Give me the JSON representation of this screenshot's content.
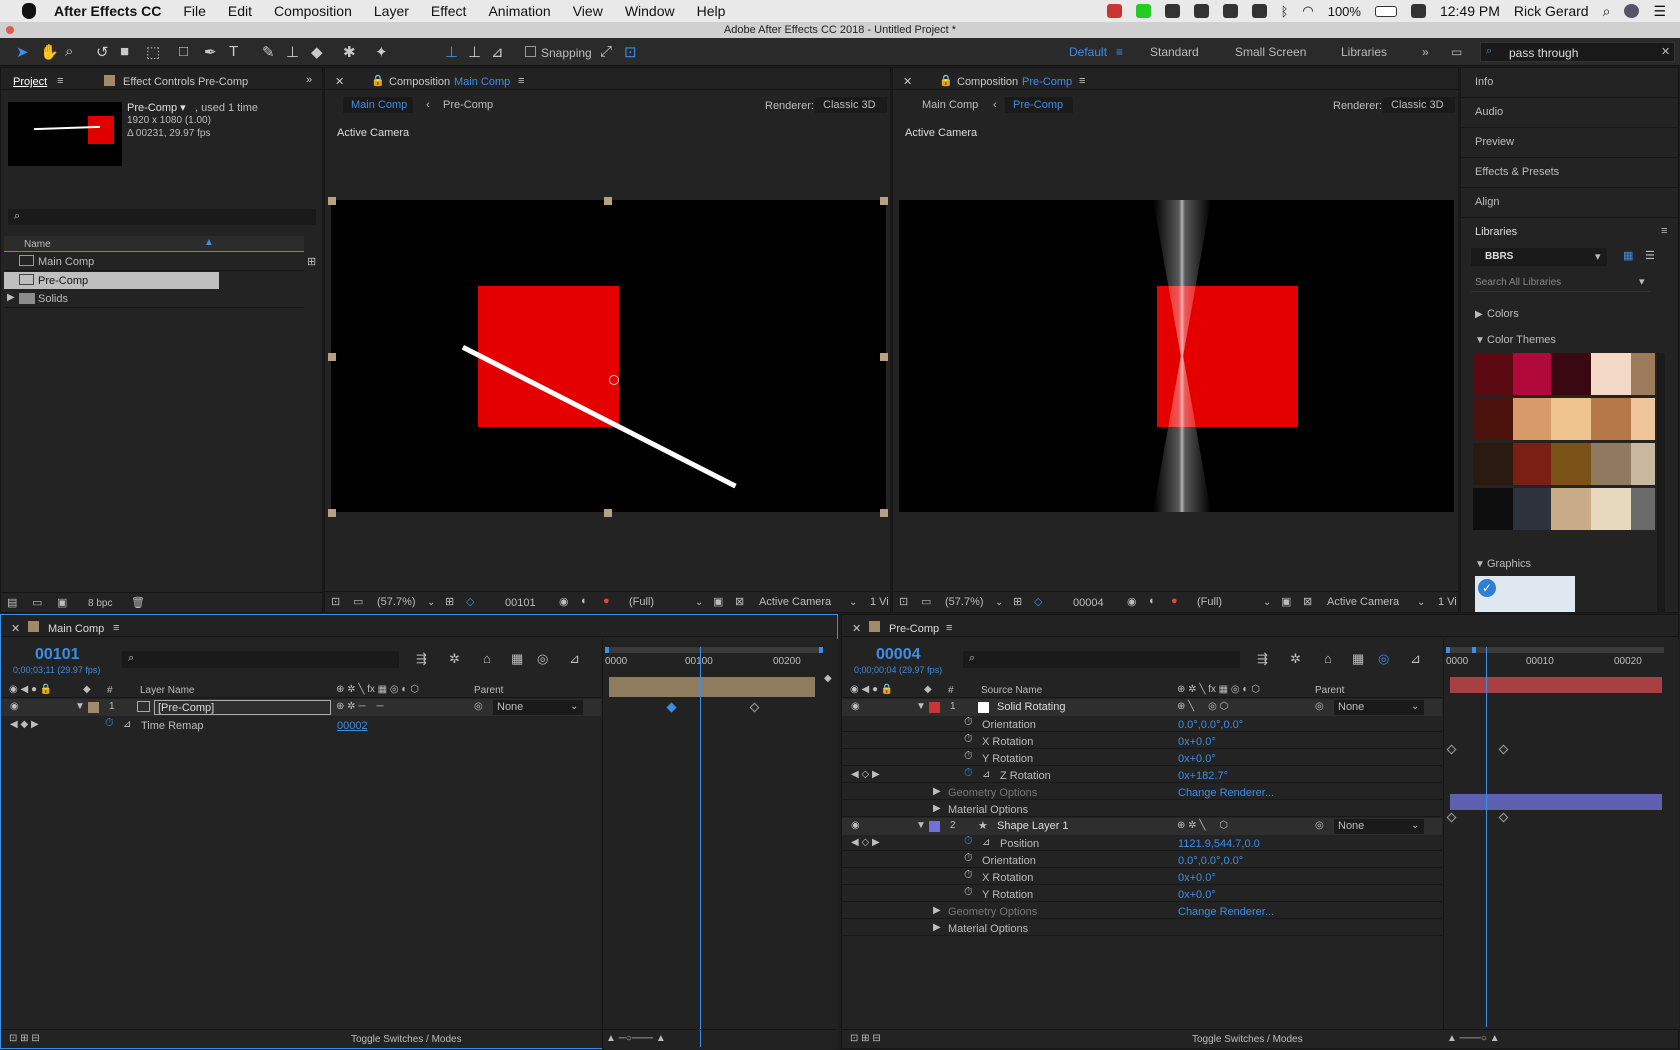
{
  "menubar": {
    "app": "After Effects CC",
    "items": [
      "File",
      "Edit",
      "Composition",
      "Layer",
      "Effect",
      "Animation",
      "View",
      "Window",
      "Help"
    ],
    "battery": "100%",
    "time": "12:49 PM",
    "user": "Rick Gerard"
  },
  "window": {
    "title": "Adobe After Effects CC 2018 - Untitled Project *"
  },
  "toolbar": {
    "snapping": "Snapping",
    "workspaces": [
      "Default",
      "Standard",
      "Small Screen",
      "Libraries"
    ],
    "search_value": "pass through"
  },
  "project": {
    "tab_project": "Project",
    "tab_effects": "Effect Controls Pre-Comp",
    "item_name": "Pre-Comp ▾",
    "item_used": ", used 1 time",
    "item_size": "1920 x 1080 (1.00)",
    "item_duration": "Δ 00231, 29.97 fps",
    "col_name": "Name",
    "items": [
      "Main Comp",
      "Pre-Comp",
      "Solids"
    ],
    "bpc": "8 bpc"
  },
  "viewer1": {
    "tab_prefix": "Composition",
    "tab_name": "Main Comp",
    "crumb_main": "Main Comp",
    "crumb_pre": "Pre-Comp",
    "renderer_label": "Renderer:",
    "renderer": "Classic 3D",
    "camera": "Active Camera",
    "zoom": "(57.7%)",
    "frame": "00101",
    "res": "(Full)",
    "view": "Active Camera",
    "views": "1 Vi"
  },
  "viewer2": {
    "tab_prefix": "Composition",
    "tab_name": "Pre-Comp",
    "crumb_main": "Main Comp",
    "crumb_pre": "Pre-Comp",
    "renderer_label": "Renderer:",
    "renderer": "Classic 3D",
    "camera": "Active Camera",
    "zoom": "(57.7%)",
    "frame": "00004",
    "res": "(Full)",
    "view": "Active Camera",
    "views": "1 Vi"
  },
  "right": {
    "items": [
      "Info",
      "Audio",
      "Preview",
      "Effects & Presets",
      "Align"
    ],
    "libraries": "Libraries",
    "library_name": "BBRS",
    "search": "Search All Libraries",
    "colors": "Colors",
    "color_themes": "Color Themes",
    "graphics": "Graphics",
    "theme_colors": [
      [
        "#5a0a10",
        "#b0093a",
        "#3a0810",
        "#f3d9c6",
        "#9e7a5c"
      ],
      [
        "#4b130c",
        "#d99a6a",
        "#f0c48e",
        "#b57648",
        "#f0c59c"
      ],
      [
        "#2a1a10",
        "#7a1f14",
        "#7a5218",
        "#8f7a5f",
        "#c8b8a0"
      ],
      [
        "#0e0e0e",
        "#2d323c",
        "#c9ab88",
        "#e6d9bd",
        "#6b6b6b"
      ]
    ]
  },
  "tl1": {
    "tab": "Main Comp",
    "timecode": "00101",
    "timecode_sub": "0;00;03;11 (29.97 fps)",
    "col_layer": "Layer Name",
    "col_parent": "Parent",
    "layer_num": "1",
    "layer_name": "[Pre-Comp]",
    "parent": "None",
    "prop": "Time Remap",
    "prop_val": "00002",
    "ruler": [
      "0000",
      "00100",
      "00200"
    ],
    "toggle": "Toggle Switches / Modes"
  },
  "tl2": {
    "tab": "Pre-Comp",
    "timecode": "00004",
    "timecode_sub": "0;00;00;04 (29.97 fps)",
    "col_source": "Source Name",
    "col_parent": "Parent",
    "ruler": [
      "0000",
      "00010",
      "00020"
    ],
    "toggle": "Toggle Switches / Modes",
    "layer1": {
      "num": "1",
      "name": "Solid Rotating",
      "parent": "None"
    },
    "layer2": {
      "num": "2",
      "name": "Shape Layer 1",
      "parent": "None"
    },
    "props1": [
      [
        "Orientation",
        "0.0°,0.0°,0.0°"
      ],
      [
        "X Rotation",
        "0x+0.0°"
      ],
      [
        "Y Rotation",
        "0x+0.0°"
      ],
      [
        "Z Rotation",
        "0x+182.7°"
      ],
      [
        "Geometry Options",
        "Change Renderer..."
      ],
      [
        "Material Options",
        ""
      ]
    ],
    "props2": [
      [
        "Position",
        "1121.9,544.7,0.0"
      ],
      [
        "Orientation",
        "0.0°,0.0°,0.0°"
      ],
      [
        "X Rotation",
        "0x+0.0°"
      ],
      [
        "Y Rotation",
        "0x+0.0°"
      ],
      [
        "Geometry Options",
        "Change Renderer..."
      ],
      [
        "Material Options",
        ""
      ]
    ]
  }
}
